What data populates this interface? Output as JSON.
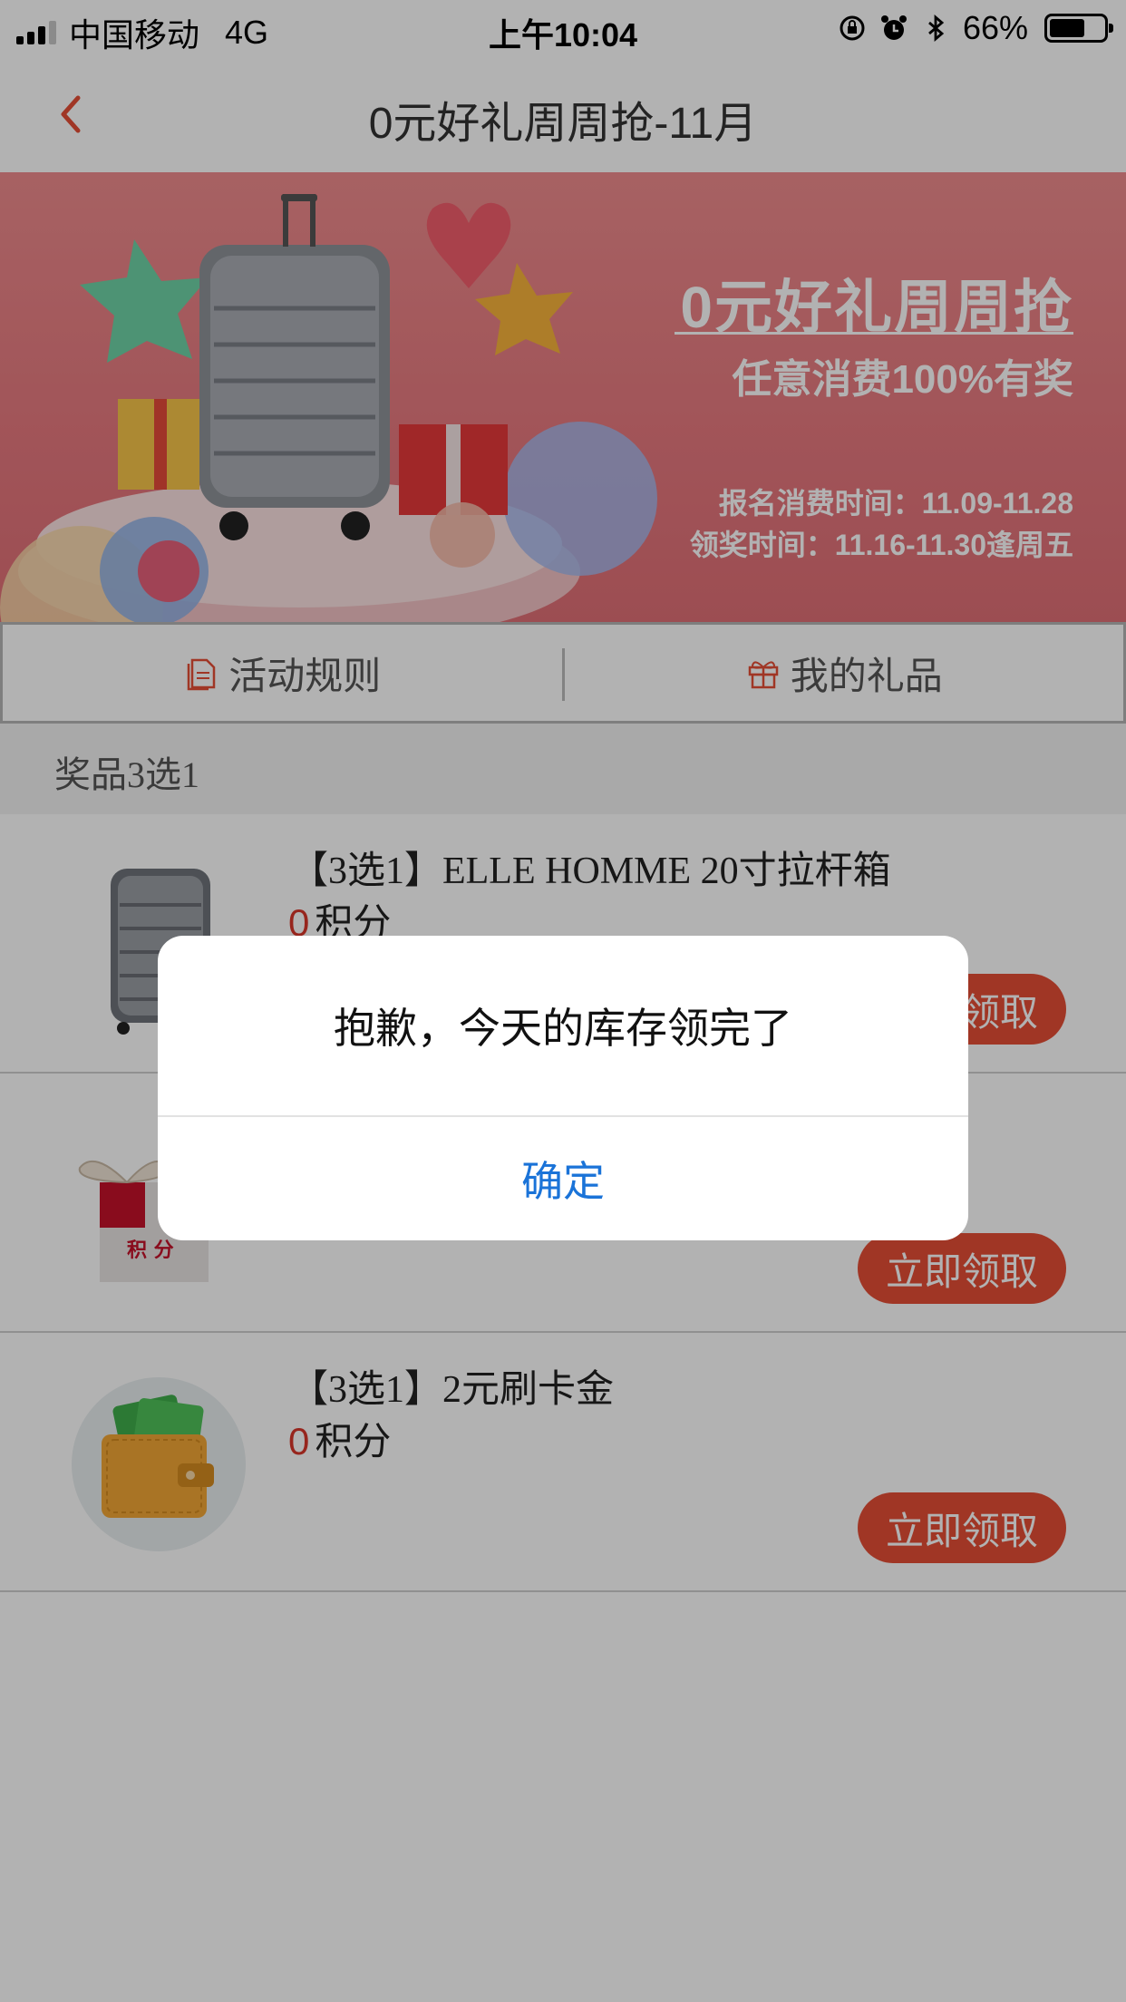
{
  "status_bar": {
    "carrier": "中国移动",
    "network": "4G",
    "time": "上午10:04",
    "battery_pct": "66%",
    "battery_level": 0.66
  },
  "nav": {
    "title": "0元好礼周周抢-11月",
    "back_icon": "chevron-left-icon"
  },
  "banner": {
    "title": "0元好礼周周抢",
    "subtitle": "任意消费100%有奖",
    "line1": "报名消费时间：11.09-11.28",
    "line2": "领奖时间：11.16-11.30逢周五"
  },
  "tabs": [
    {
      "label": "活动规则",
      "icon": "document-icon"
    },
    {
      "label": "我的礼品",
      "icon": "gift-icon"
    }
  ],
  "section": {
    "title": "奖品3选1"
  },
  "items": [
    {
      "name": "【3选1】ELLE HOMME 20寸拉杆箱",
      "points": "0",
      "points_unit": "积分",
      "button": "立即领取",
      "icon": "suitcase-icon"
    },
    {
      "name": "",
      "points": "",
      "points_unit": "",
      "button": "立即领取",
      "icon": "points-gift-box-icon",
      "image_text": "积 分"
    },
    {
      "name": "【3选1】2元刷卡金",
      "points": "0",
      "points_unit": "积分",
      "button": "立即领取",
      "icon": "wallet-cash-icon"
    }
  ],
  "dialog": {
    "message": "抱歉，今天的库存领完了",
    "confirm": "确定"
  },
  "colors": {
    "accent": "#e54e36",
    "points_red": "#d8362a",
    "dialog_link": "#1a73d8",
    "banner_pink": "#e87a80"
  }
}
